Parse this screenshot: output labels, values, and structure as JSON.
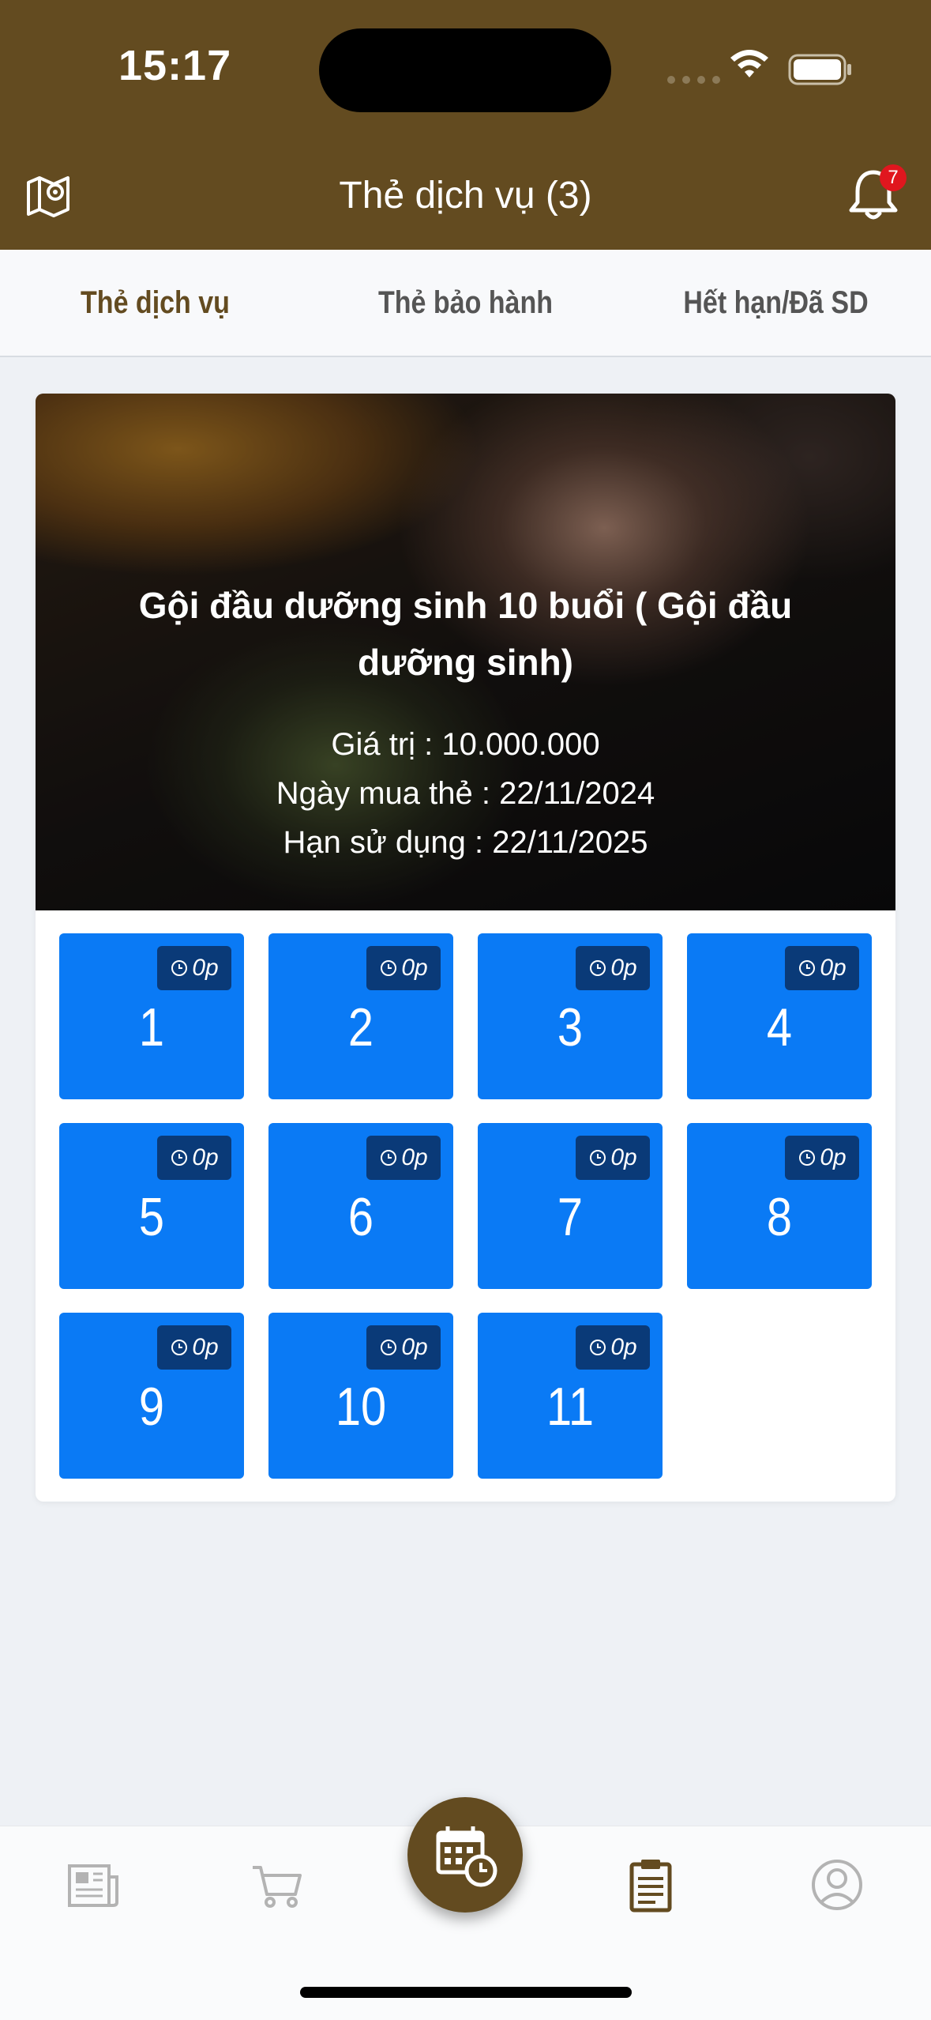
{
  "status_bar": {
    "time": "15:17"
  },
  "nav": {
    "title": "Thẻ dịch vụ (3)",
    "notification_count": "7"
  },
  "tabs": [
    {
      "label": "Thẻ dịch vụ",
      "active": true
    },
    {
      "label": "Thẻ bảo hành",
      "active": false
    },
    {
      "label": "Hết hạn/Đã SD",
      "active": false
    }
  ],
  "card": {
    "title": "Gội đầu dưỡng sinh 10 buổi ( Gội đầu dưỡng sinh)",
    "value_line": "Giá trị : 10.000.000",
    "purchase_line": "Ngày mua thẻ : 22/11/2024",
    "expiry_line": "Hạn sử dụng : 22/11/2025",
    "sessions": [
      {
        "number": "1",
        "duration": "0p"
      },
      {
        "number": "2",
        "duration": "0p"
      },
      {
        "number": "3",
        "duration": "0p"
      },
      {
        "number": "4",
        "duration": "0p"
      },
      {
        "number": "5",
        "duration": "0p"
      },
      {
        "number": "6",
        "duration": "0p"
      },
      {
        "number": "7",
        "duration": "0p"
      },
      {
        "number": "8",
        "duration": "0p"
      },
      {
        "number": "9",
        "duration": "0p"
      },
      {
        "number": "10",
        "duration": "0p"
      },
      {
        "number": "11",
        "duration": "0p"
      }
    ]
  },
  "bottom_nav": [
    {
      "icon": "news-icon"
    },
    {
      "icon": "cart-icon"
    },
    {
      "icon": "calendar-clock-icon"
    },
    {
      "icon": "clipboard-icon",
      "active": true
    },
    {
      "icon": "user-icon"
    }
  ],
  "colors": {
    "header": "#634b20",
    "tile": "#0a7af5",
    "tile_tag": "#0a3a78",
    "active_tab": "#634b20",
    "badge": "#e0161e"
  }
}
